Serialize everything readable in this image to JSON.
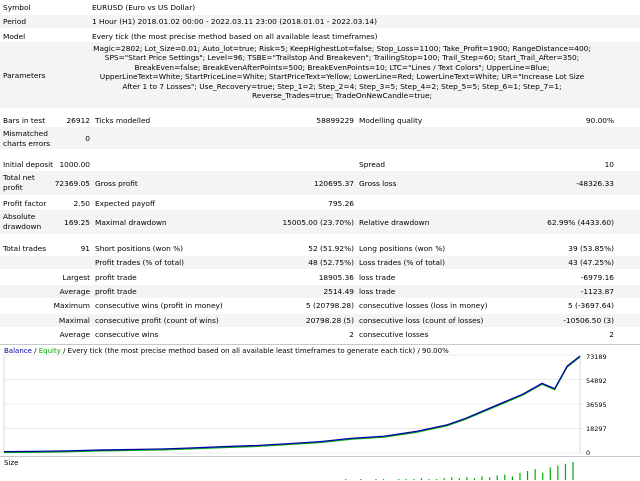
{
  "header": {
    "symbol_label": "Symbol",
    "symbol_value": "EURUSD (Euro vs US Dollar)",
    "period_label": "Period",
    "period_value": "1 Hour (H1) 2018.01.02 00:00 - 2022.03.11 23:00 (2018.01.01 - 2022.03.14)",
    "model_label": "Model",
    "model_value": "Every tick (the most precise method based on all available least timeframes)",
    "parameters_label": "Parameters",
    "parameters_value": "Magic=2802; Lot_Size=0.01; Auto_lot=true; Risk=5; KeepHighestLot=false; Stop_Loss=1100; Take_Profit=1900; RangeDistance=400; SPS=\"Start Price Settings\"; Level=96; TSBE=\"Trailstop And Breakeven\"; TrailingStop=100; Trail_Step=60; Start_Trail_After=350; BreakEven=false; BreakEvenAfterPoints=500; BreakEvenPoints=10; LTC=\"Lines / Text Colors\"; UpperLine=Blue; UpperLineText=White; StartPriceLine=White; StartPriceText=Yellow; LowerLine=Red; LowerLineText=White; UR=\"Increase Lot Size After 1 to 7 Losses\"; Use_Recovery=true; Step_1=2; Step_2=4; Step_3=5; Step_4=2; Step_5=5; Step_6=1; Step_7=1; Reverse_Trades=true; TradeOnNewCandle=true;"
  },
  "stats": {
    "bars_label": "Bars in test",
    "bars_value": "26912",
    "ticks_label": "Ticks modelled",
    "ticks_value": "58899229",
    "quality_label": "Modelling quality",
    "quality_value": "90.00%",
    "mismatch_label_1": "Mismatched",
    "mismatch_label_2": "charts errors",
    "mismatch_value": "0",
    "deposit_label": "Initial deposit",
    "deposit_value": "1000.00",
    "spread_label": "Spread",
    "spread_value": "10",
    "netprofit_label_1": "Total net",
    "netprofit_label_2": "profit",
    "netprofit_value": "72369.05",
    "grossprofit_label": "Gross profit",
    "grossprofit_value": "120695.37",
    "grossloss_label": "Gross loss",
    "grossloss_value": "-48326.33",
    "pf_label": "Profit factor",
    "pf_value": "2.50",
    "ep_label": "Expected payoff",
    "ep_value": "795.26",
    "absdd_label_1": "Absolute",
    "absdd_label_2": "drawdown",
    "absdd_value": "169.25",
    "maxdd_label": "Maximal drawdown",
    "maxdd_value": "15005.00 (23.70%)",
    "reldd_label": "Relative drawdown",
    "reldd_value": "62.99% (4433.60)",
    "totaltrades_label": "Total trades",
    "totaltrades_value": "91",
    "short_label": "Short positions (won %)",
    "short_value": "52 (51.92%)",
    "long_label": "Long positions (won %)",
    "long_value": "39 (53.85%)",
    "profittrades_label": "Profit trades (% of total)",
    "profittrades_value": "48 (52.75%)",
    "losstrades_label": "Loss trades (% of total)",
    "losstrades_value": "43 (47.25%)",
    "largest_label": "Largest",
    "largest_pt_label": "profit trade",
    "largest_pt_value": "18905.36",
    "largest_lt_label": "loss trade",
    "largest_lt_value": "-6979.16",
    "average_label": "Average",
    "average_pt_label": "profit trade",
    "average_pt_value": "2514.49",
    "average_lt_label": "loss trade",
    "average_lt_value": "-1123.87",
    "maximum_label": "Maximum",
    "max_cw_label": "consecutive wins (profit in money)",
    "max_cw_value": "5 (20798.28)",
    "max_cl_label": "consecutive losses (loss in money)",
    "max_cl_value": "5 (-3697.64)",
    "maximal_label": "Maximal",
    "maximal_cp_label": "consecutive profit (count of wins)",
    "maximal_cp_value": "20798.28 (5)",
    "maximal_cl_label": "consecutive loss (count of losses)",
    "maximal_cl_value": "-10506.50 (3)",
    "avgc_label": "Average",
    "avgc_w_label": "consecutive wins",
    "avgc_w_value": "2",
    "avgc_l_label": "consecutive losses",
    "avgc_l_value": "2"
  },
  "chart_data": {
    "type": "line",
    "title": "Balance / Equity / Every tick (the most precise method based on all available least timeframes to generate each tick) / 90.00%",
    "legend_balance": "Balance",
    "legend_sep1": " / ",
    "legend_equity": "Equity",
    "legend_rest": " / Every tick (the most precise method based on all available least timeframes to generate each tick) / 90.00%",
    "ylim": [
      0,
      73189
    ],
    "yticks": [
      "73189",
      "54892",
      "36595",
      "18297",
      "0"
    ],
    "x": [
      0,
      5,
      10,
      15,
      20,
      25,
      30,
      35,
      40,
      45,
      50,
      55,
      60,
      65,
      70,
      73,
      76,
      79,
      82,
      85,
      87,
      89,
      91
    ],
    "y": [
      1000,
      1200,
      1600,
      2200,
      2600,
      3000,
      3800,
      4800,
      5600,
      7000,
      8500,
      11000,
      12500,
      16000,
      21000,
      26000,
      32000,
      38000,
      44000,
      52000,
      48000,
      65000,
      72369
    ],
    "xlim": [
      0,
      91
    ],
    "balance_color": "#0000aa",
    "equity_color": "#00aa00"
  },
  "size_panel": {
    "label": "Size",
    "bars": [
      0,
      0,
      0,
      0,
      0,
      0,
      0,
      0,
      0,
      0,
      0,
      0,
      0,
      0,
      0,
      0,
      0,
      0,
      0,
      0,
      0,
      0,
      0,
      0,
      0,
      0,
      0,
      0,
      0,
      0,
      0,
      0,
      0,
      0,
      0,
      0,
      0,
      0,
      0,
      0,
      0,
      0,
      0,
      0,
      0,
      1,
      0,
      1,
      0,
      1,
      1,
      0,
      1,
      1,
      1,
      2,
      1,
      1,
      2,
      3,
      2,
      3,
      2,
      4,
      3,
      5,
      6,
      4,
      8,
      10,
      12,
      8,
      14,
      16,
      18,
      20
    ]
  }
}
